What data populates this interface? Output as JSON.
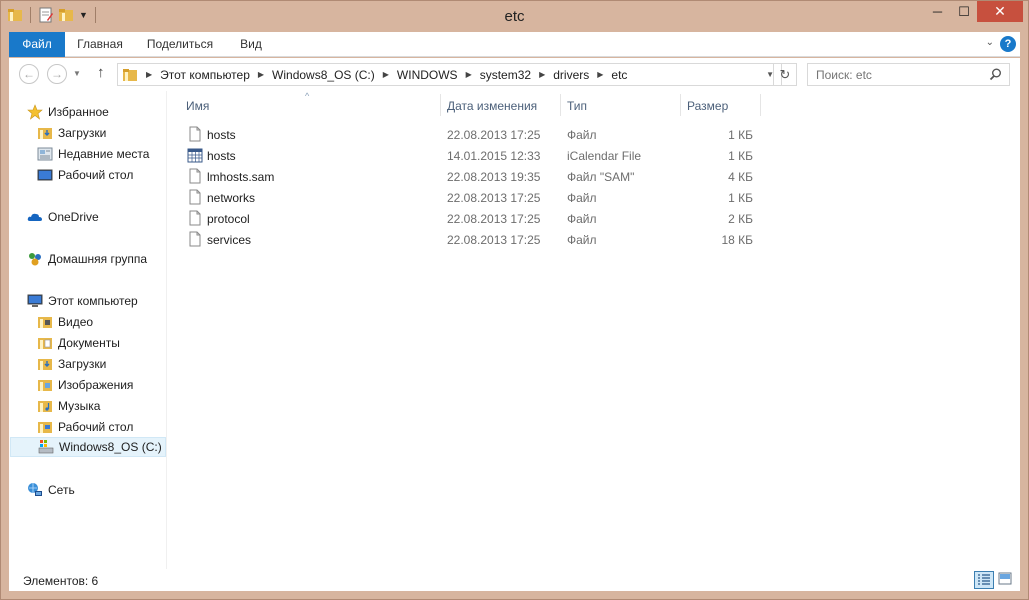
{
  "window": {
    "title": "etc"
  },
  "ribbon": {
    "tabs": [
      {
        "label": "Файл"
      },
      {
        "label": "Главная"
      },
      {
        "label": "Поделиться"
      },
      {
        "label": "Вид"
      }
    ]
  },
  "nav": {
    "breadcrumbs": [
      "Этот компьютер",
      "Windows8_OS (C:)",
      "WINDOWS",
      "system32",
      "drivers",
      "etc"
    ],
    "search_placeholder": "Поиск: etc"
  },
  "sidebar": {
    "favorites": {
      "label": "Избранное",
      "items": [
        "Загрузки",
        "Недавние места",
        "Рабочий стол"
      ]
    },
    "onedrive": {
      "label": "OneDrive"
    },
    "homegroup": {
      "label": "Домашняя группа"
    },
    "computer": {
      "label": "Этот компьютер",
      "items": [
        "Видео",
        "Документы",
        "Загрузки",
        "Изображения",
        "Музыка",
        "Рабочий стол",
        "Windows8_OS (C:)"
      ]
    },
    "network": {
      "label": "Сеть"
    }
  },
  "columns": {
    "name": "Имя",
    "date": "Дата изменения",
    "type": "Тип",
    "size": "Размер"
  },
  "files": [
    {
      "name": "hosts",
      "date": "22.08.2013 17:25",
      "type": "Файл",
      "size": "1 КБ",
      "icon": "file-icon"
    },
    {
      "name": "hosts",
      "date": "14.01.2015 12:33",
      "type": "iCalendar File",
      "size": "1 КБ",
      "icon": "calendar-file-icon"
    },
    {
      "name": "lmhosts.sam",
      "date": "22.08.2013 19:35",
      "type": "Файл \"SAM\"",
      "size": "4 КБ",
      "icon": "file-icon"
    },
    {
      "name": "networks",
      "date": "22.08.2013 17:25",
      "type": "Файл",
      "size": "1 КБ",
      "icon": "file-icon"
    },
    {
      "name": "protocol",
      "date": "22.08.2013 17:25",
      "type": "Файл",
      "size": "2 КБ",
      "icon": "file-icon"
    },
    {
      "name": "services",
      "date": "22.08.2013 17:25",
      "type": "Файл",
      "size": "18 КБ",
      "icon": "file-icon"
    }
  ],
  "status": {
    "items_count": "Элементов: 6"
  },
  "colors": {
    "accent": "#1979ca",
    "frame": "#d7b59f",
    "close": "#c7503e",
    "selected": "#e5f3fb"
  }
}
